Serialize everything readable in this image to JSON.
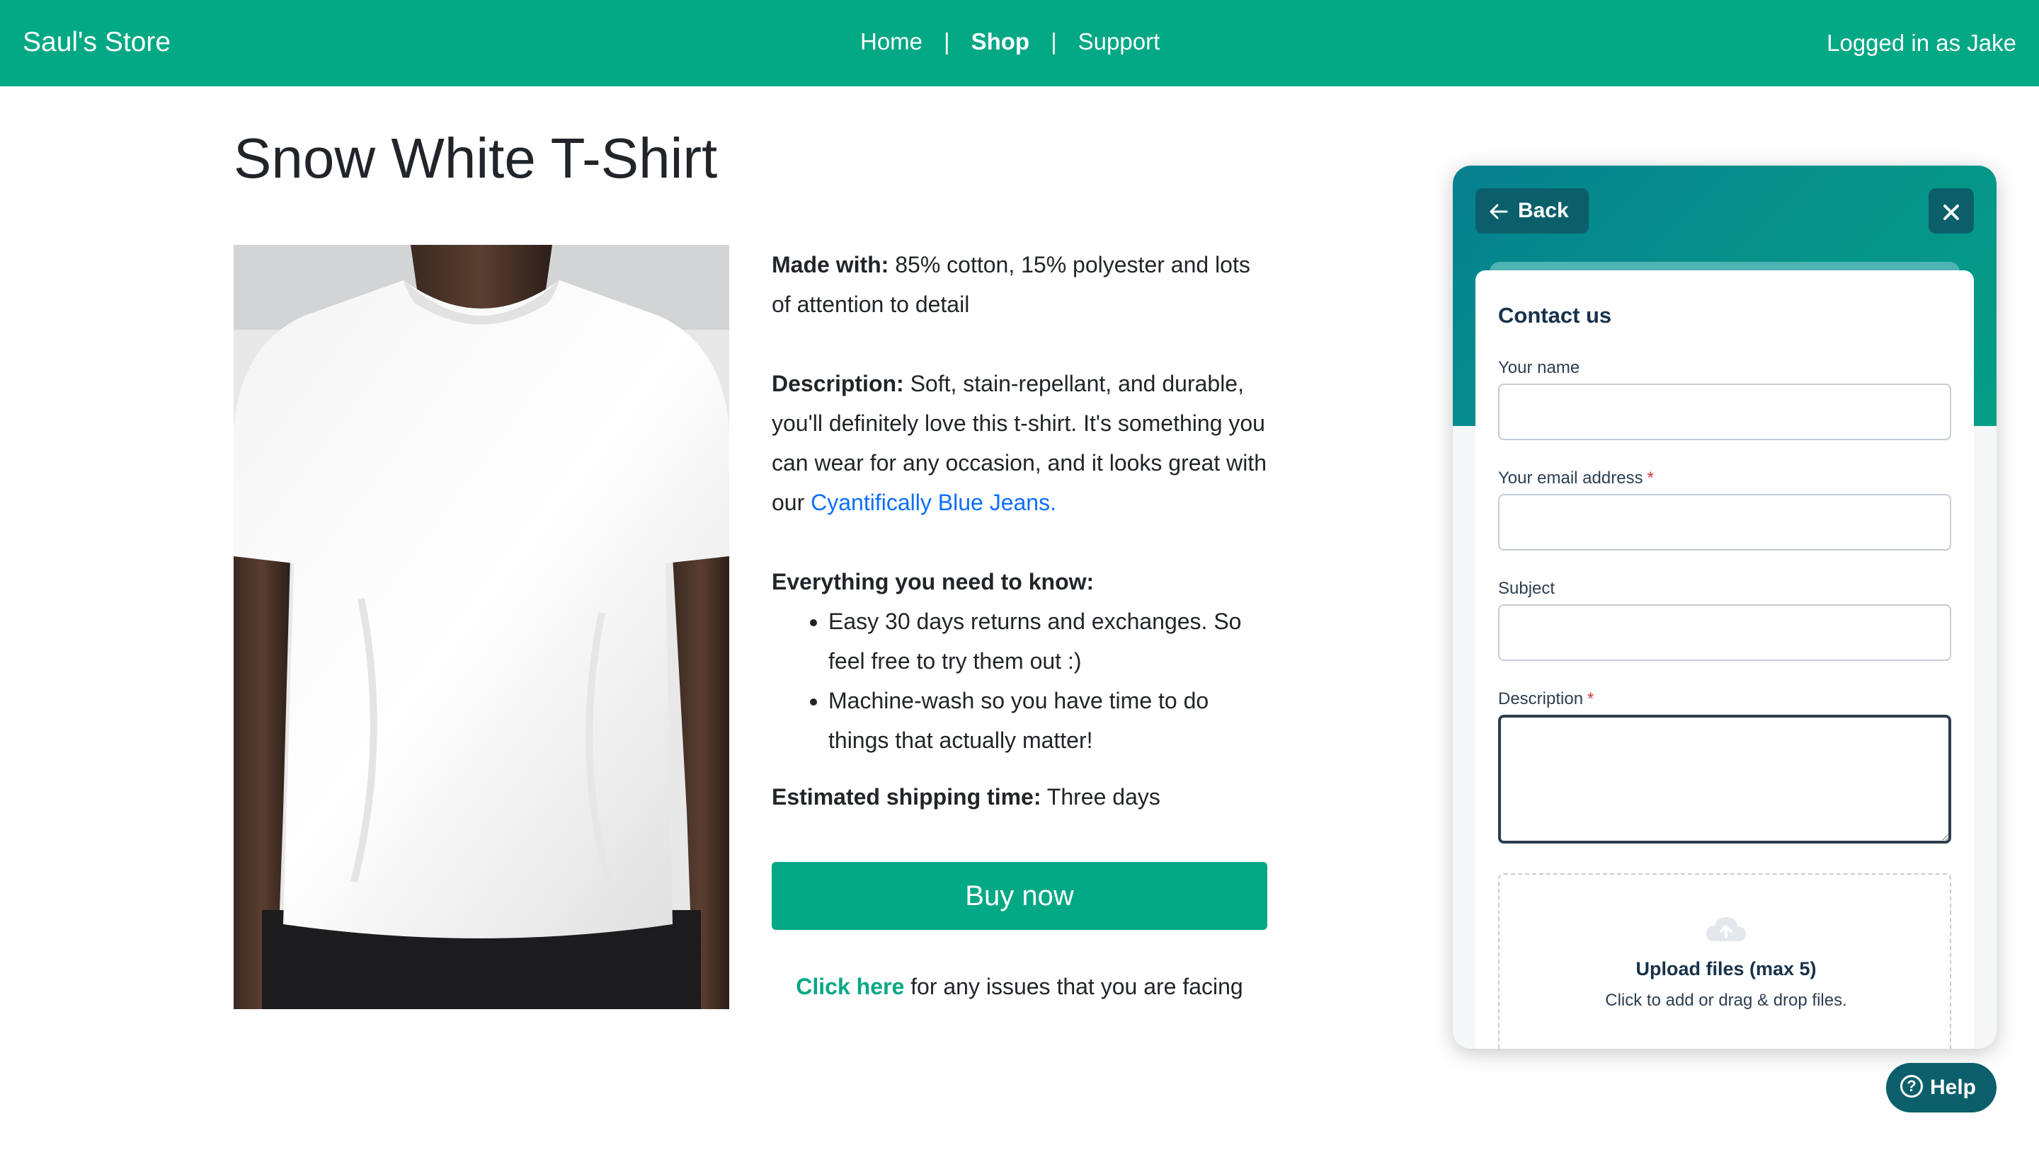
{
  "header": {
    "brand": "Saul's Store",
    "nav": [
      "Home",
      "Shop",
      "Support"
    ],
    "nav_separator": "|",
    "active_nav": "Shop",
    "user_status": "Logged in as Jake"
  },
  "product": {
    "title": "Snow White T-Shirt",
    "made_with_label": "Made with:",
    "made_with_value": " 85% cotton, 15% polyester and lots of attention to detail",
    "description_label": "Description:",
    "description_value": " Soft, stain-repellant, and durable, you'll definitely love this t-shirt. It's something you can wear for any occasion, and it looks great with our ",
    "description_link": "Cyantifically Blue Jeans.",
    "need_to_know_label": "Everything you need to know:",
    "need_to_know_items": [
      "Easy 30 days returns and exchanges. So feel free to try them out :)",
      "Machine-wash so you have time to do things that actually matter!"
    ],
    "shipping_label": "Estimated shipping time:",
    "shipping_value": " Three days",
    "buy_button": "Buy now",
    "issues_link": "Click here",
    "issues_text": " for any issues that you are facing"
  },
  "widget": {
    "back_label": "Back",
    "close_icon": "close-icon",
    "title": "Contact us",
    "fields": [
      {
        "label": "Your name",
        "required": false,
        "value": ""
      },
      {
        "label": "Your email address",
        "required": true,
        "value": ""
      },
      {
        "label": "Subject",
        "required": false,
        "value": ""
      },
      {
        "label": "Description",
        "required": true,
        "value": ""
      }
    ],
    "required_marker": "*",
    "upload_title": "Upload files (max 5)",
    "upload_subtitle": "Click to add or drag & drop files.",
    "help_label": "Help"
  },
  "colors": {
    "brand": "#03a884",
    "widget_dark": "#0b5f6b",
    "link_blue": "#0d6efd"
  }
}
